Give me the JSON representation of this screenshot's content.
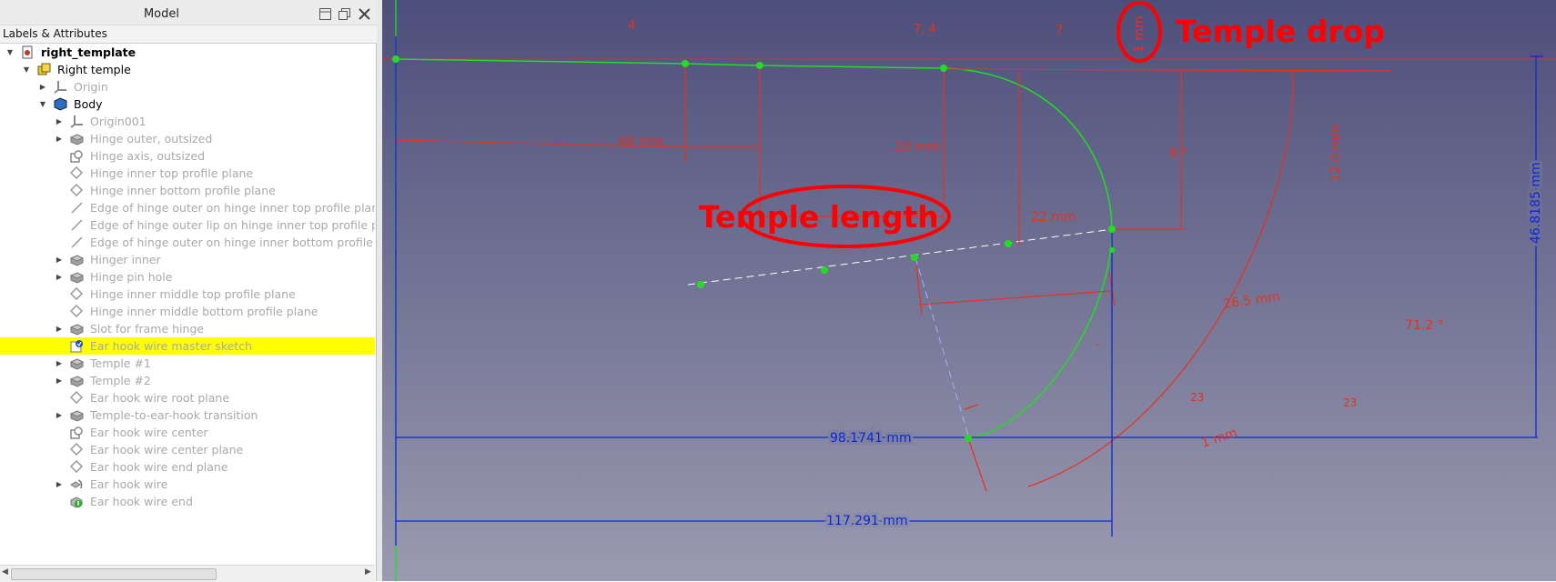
{
  "panel": {
    "title": "Model",
    "header": "Labels & Attributes"
  },
  "tree": [
    {
      "label": "right_template",
      "style": "bold",
      "level": 0,
      "expander": "open",
      "icon": "document-icon"
    },
    {
      "label": "Right temple",
      "style": "active",
      "level": 1,
      "expander": "open",
      "icon": "part-icon"
    },
    {
      "label": "Origin",
      "style": "dim",
      "level": 2,
      "expander": "closed",
      "icon": "axes-icon"
    },
    {
      "label": "Body",
      "style": "active",
      "level": 2,
      "expander": "open",
      "icon": "body-icon"
    },
    {
      "label": "Origin001",
      "style": "dim",
      "level": 3,
      "expander": "closed",
      "icon": "axes-icon"
    },
    {
      "label": "Hinge outer, outsized",
      "style": "dim",
      "level": 3,
      "expander": "closed",
      "icon": "feature-icon"
    },
    {
      "label": "Hinge axis, outsized",
      "style": "dim",
      "level": 3,
      "expander": "none",
      "icon": "datum-icon"
    },
    {
      "label": "Hinge inner top profile plane",
      "style": "dim",
      "level": 3,
      "expander": "none",
      "icon": "plane-icon"
    },
    {
      "label": "Hinge inner bottom profile plane",
      "style": "dim",
      "level": 3,
      "expander": "none",
      "icon": "plane-icon"
    },
    {
      "label": "Edge of hinge outer on hinge inner top profile plane",
      "style": "dim",
      "level": 3,
      "expander": "none",
      "icon": "line-icon"
    },
    {
      "label": "Edge of hinge outer lip on hinge inner top profile plane",
      "style": "dim",
      "level": 3,
      "expander": "none",
      "icon": "line-icon"
    },
    {
      "label": "Edge of hinge outer on hinge inner bottom profile plane",
      "style": "dim",
      "level": 3,
      "expander": "none",
      "icon": "line-icon"
    },
    {
      "label": "Hinger inner",
      "style": "dim",
      "level": 3,
      "expander": "closed",
      "icon": "feature-icon"
    },
    {
      "label": "Hinge pin hole",
      "style": "dim",
      "level": 3,
      "expander": "closed",
      "icon": "feature-icon"
    },
    {
      "label": "Hinge inner middle top profile plane",
      "style": "dim",
      "level": 3,
      "expander": "none",
      "icon": "plane-icon"
    },
    {
      "label": "Hinge inner middle bottom profile plane",
      "style": "dim",
      "level": 3,
      "expander": "none",
      "icon": "plane-icon"
    },
    {
      "label": "Slot for frame hinge",
      "style": "dim",
      "level": 3,
      "expander": "closed",
      "icon": "feature-icon"
    },
    {
      "label": "Ear hook wire master sketch",
      "style": "dim",
      "level": 3,
      "expander": "none",
      "icon": "sketch-icon",
      "selected": true
    },
    {
      "label": "Temple #1",
      "style": "dim",
      "level": 3,
      "expander": "closed",
      "icon": "feature-icon"
    },
    {
      "label": "Temple #2",
      "style": "dim",
      "level": 3,
      "expander": "closed",
      "icon": "feature-icon"
    },
    {
      "label": "Ear hook wire root plane",
      "style": "dim",
      "level": 3,
      "expander": "none",
      "icon": "plane-icon"
    },
    {
      "label": "Temple-to-ear-hook transition",
      "style": "dim",
      "level": 3,
      "expander": "closed",
      "icon": "feature-icon"
    },
    {
      "label": "Ear hook wire center",
      "style": "dim",
      "level": 3,
      "expander": "none",
      "icon": "datum-icon"
    },
    {
      "label": "Ear hook wire center plane",
      "style": "dim",
      "level": 3,
      "expander": "none",
      "icon": "plane-icon"
    },
    {
      "label": "Ear hook wire end plane",
      "style": "dim",
      "level": 3,
      "expander": "none",
      "icon": "plane-icon"
    },
    {
      "label": "Ear hook wire",
      "style": "dim",
      "level": 3,
      "expander": "closed",
      "icon": "sweep-icon"
    },
    {
      "label": "Ear hook wire end",
      "style": "dim",
      "level": 3,
      "expander": "none",
      "icon": "endpoint-icon"
    }
  ],
  "viewport": {
    "constraints_top": [
      "4",
      "7, 4",
      "7"
    ],
    "dims": {
      "d60": "60 mm",
      "d10": "10 mm",
      "d22": "22 mm",
      "d8deg": "8 °",
      "d12": "12.0 mm",
      "d1": "1 mm",
      "d26": "26.5 mm",
      "d71": "71.2 °",
      "d46": "46.8185 mm",
      "d98": "98.1741 mm",
      "d117": "117.291 mm",
      "d1b": "1 mm",
      "c23a": "23",
      "c23b": "23"
    },
    "annotations": {
      "temple_drop": "Temple drop",
      "temple_length": "Temple length"
    },
    "colors": {
      "background_top": "#4d4f7b",
      "background_bottom": "#9a9ab0",
      "sketch_line": "#22dd22",
      "constraint_red": "#e8301e",
      "dimension_blue": "#0a28d6",
      "annotation_red": "#ff0000",
      "selection": "#ffff00"
    }
  }
}
